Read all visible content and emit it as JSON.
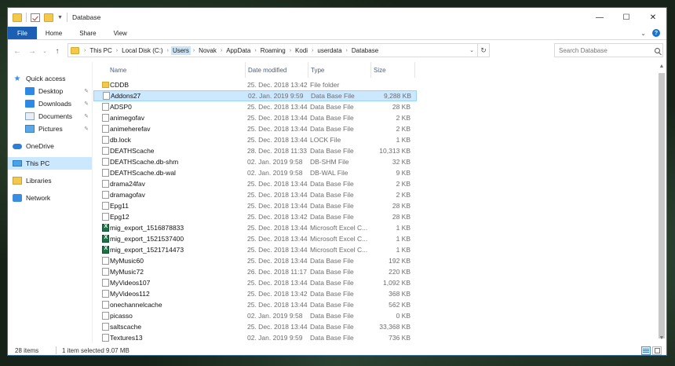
{
  "window": {
    "title": "Database",
    "controls": {
      "minimize": "—",
      "maximize": "☐",
      "close": "✕"
    }
  },
  "ribbon": {
    "tabs": [
      {
        "label": "File",
        "active": true
      },
      {
        "label": "Home"
      },
      {
        "label": "Share"
      },
      {
        "label": "View"
      }
    ]
  },
  "address": {
    "crumbs": [
      "This PC",
      "Local Disk (C:)",
      "Users",
      "Novak",
      "AppData",
      "Roaming",
      "Kodi",
      "userdata",
      "Database"
    ],
    "highlighted": "Users",
    "search_placeholder": "Search Database"
  },
  "nav": {
    "items": [
      {
        "label": "Quick access",
        "icon": "star-icon",
        "type": "root"
      },
      {
        "label": "Desktop",
        "icon": "desktop-icon",
        "type": "sub",
        "pinned": true
      },
      {
        "label": "Downloads",
        "icon": "downloads-icon",
        "type": "sub",
        "pinned": true
      },
      {
        "label": "Documents",
        "icon": "documents-icon",
        "type": "sub",
        "pinned": true
      },
      {
        "label": "Pictures",
        "icon": "pictures-icon",
        "type": "sub",
        "pinned": true
      },
      {
        "label": "OneDrive",
        "icon": "onedrive-icon",
        "type": "root"
      },
      {
        "label": "This PC",
        "icon": "this-pc-icon",
        "type": "root",
        "selected": true
      },
      {
        "label": "Libraries",
        "icon": "libraries-icon",
        "type": "root"
      },
      {
        "label": "Network",
        "icon": "network-icon",
        "type": "root"
      }
    ]
  },
  "columns": {
    "name": "Name",
    "date": "Date modified",
    "type": "Type",
    "size": "Size"
  },
  "files": [
    {
      "name": "CDDB",
      "date": "25. Dec. 2018 13:42",
      "type": "File folder",
      "size": "",
      "icon": "folder"
    },
    {
      "name": "Addons27",
      "date": "02. Jan. 2019 9:59",
      "type": "Data Base File",
      "size": "9,288 KB",
      "icon": "file",
      "selected": true
    },
    {
      "name": "ADSP0",
      "date": "25. Dec. 2018 13:44",
      "type": "Data Base File",
      "size": "28 KB",
      "icon": "file"
    },
    {
      "name": "animegofav",
      "date": "25. Dec. 2018 13:44",
      "type": "Data Base File",
      "size": "2 KB",
      "icon": "file"
    },
    {
      "name": "animeherefav",
      "date": "25. Dec. 2018 13:44",
      "type": "Data Base File",
      "size": "2 KB",
      "icon": "file"
    },
    {
      "name": "db.lock",
      "date": "25. Dec. 2018 13:44",
      "type": "LOCK File",
      "size": "1 KB",
      "icon": "file"
    },
    {
      "name": "DEATHScache",
      "date": "28. Dec. 2018 11:33",
      "type": "Data Base File",
      "size": "10,313 KB",
      "icon": "file"
    },
    {
      "name": "DEATHScache.db-shm",
      "date": "02. Jan. 2019 9:58",
      "type": "DB-SHM File",
      "size": "32 KB",
      "icon": "file"
    },
    {
      "name": "DEATHScache.db-wal",
      "date": "02. Jan. 2019 9:58",
      "type": "DB-WAL File",
      "size": "9 KB",
      "icon": "file"
    },
    {
      "name": "drama24fav",
      "date": "25. Dec. 2018 13:44",
      "type": "Data Base File",
      "size": "2 KB",
      "icon": "file"
    },
    {
      "name": "dramagofav",
      "date": "25. Dec. 2018 13:44",
      "type": "Data Base File",
      "size": "2 KB",
      "icon": "file"
    },
    {
      "name": "Epg11",
      "date": "25. Dec. 2018 13:44",
      "type": "Data Base File",
      "size": "28 KB",
      "icon": "file"
    },
    {
      "name": "Epg12",
      "date": "25. Dec. 2018 13:42",
      "type": "Data Base File",
      "size": "28 KB",
      "icon": "file"
    },
    {
      "name": "mig_export_1516878833",
      "date": "25. Dec. 2018 13:44",
      "type": "Microsoft Excel C...",
      "size": "1 KB",
      "icon": "excel"
    },
    {
      "name": "mig_export_1521537400",
      "date": "25. Dec. 2018 13:44",
      "type": "Microsoft Excel C...",
      "size": "1 KB",
      "icon": "excel"
    },
    {
      "name": "mig_export_1521714473",
      "date": "25. Dec. 2018 13:44",
      "type": "Microsoft Excel C...",
      "size": "1 KB",
      "icon": "excel"
    },
    {
      "name": "MyMusic60",
      "date": "25. Dec. 2018 13:44",
      "type": "Data Base File",
      "size": "192 KB",
      "icon": "file"
    },
    {
      "name": "MyMusic72",
      "date": "26. Dec. 2018 11:17",
      "type": "Data Base File",
      "size": "220 KB",
      "icon": "file"
    },
    {
      "name": "MyVideos107",
      "date": "25. Dec. 2018 13:44",
      "type": "Data Base File",
      "size": "1,092 KB",
      "icon": "file"
    },
    {
      "name": "MyVideos112",
      "date": "25. Dec. 2018 13:42",
      "type": "Data Base File",
      "size": "368 KB",
      "icon": "file"
    },
    {
      "name": "onechannelcache",
      "date": "25. Dec. 2018 13:44",
      "type": "Data Base File",
      "size": "562 KB",
      "icon": "file"
    },
    {
      "name": "picasso",
      "date": "02. Jan. 2019 9:58",
      "type": "Data Base File",
      "size": "0 KB",
      "icon": "file"
    },
    {
      "name": "saltscache",
      "date": "25. Dec. 2018 13:44",
      "type": "Data Base File",
      "size": "33,368 KB",
      "icon": "file"
    },
    {
      "name": "Textures13",
      "date": "02. Jan. 2019 9:59",
      "type": "Data Base File",
      "size": "736 KB",
      "icon": "file"
    }
  ],
  "status": {
    "count": "28 items",
    "selection": "1 item selected  9.07 MB"
  },
  "colors": {
    "accent": "#1a5fb4",
    "selection": "#cce8ff",
    "folder": "#f2c94c"
  }
}
